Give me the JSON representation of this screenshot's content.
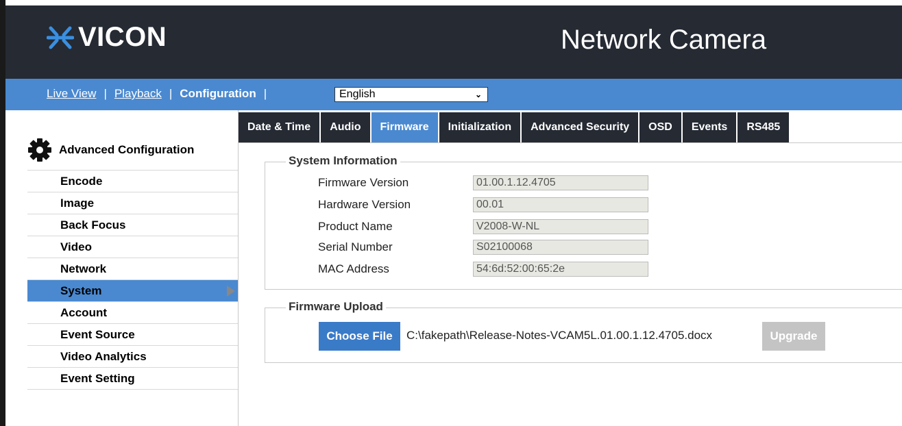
{
  "header": {
    "logo_text": "VICON",
    "product_title": "Network Camera"
  },
  "nav": {
    "live_view": "Live View",
    "playback": "Playback",
    "configuration": "Configuration",
    "separator": "|",
    "language": "English"
  },
  "sidebar": {
    "title": "Advanced Configuration",
    "items": [
      {
        "label": "Encode"
      },
      {
        "label": "Image"
      },
      {
        "label": "Back Focus"
      },
      {
        "label": "Video"
      },
      {
        "label": "Network"
      },
      {
        "label": "System"
      },
      {
        "label": "Account"
      },
      {
        "label": "Event Source"
      },
      {
        "label": "Video Analytics"
      },
      {
        "label": "Event Setting"
      }
    ]
  },
  "tabs": [
    {
      "label": "Date & Time"
    },
    {
      "label": "Audio"
    },
    {
      "label": "Firmware"
    },
    {
      "label": "Initialization"
    },
    {
      "label": "Advanced Security"
    },
    {
      "label": "OSD"
    },
    {
      "label": "Events"
    },
    {
      "label": "RS485"
    }
  ],
  "system_info": {
    "title": "System Information",
    "rows": [
      {
        "label": "Firmware Version",
        "value": "01.00.1.12.4705"
      },
      {
        "label": "Hardware Version",
        "value": "00.01"
      },
      {
        "label": "Product Name",
        "value": "V2008-W-NL"
      },
      {
        "label": "Serial Number",
        "value": "S02100068"
      },
      {
        "label": "MAC Address",
        "value": "54:6d:52:00:65:2e"
      }
    ]
  },
  "firmware_upload": {
    "title": "Firmware Upload",
    "choose_label": "Choose File",
    "file_path": "C:\\fakepath\\Release-Notes-VCAM5L.01.00.1.12.4705.docx",
    "upgrade_label": "Upgrade"
  },
  "colors": {
    "header_bg": "#252a33",
    "accent_blue": "#4a89d0",
    "disabled_gray": "#c4c4c4"
  }
}
